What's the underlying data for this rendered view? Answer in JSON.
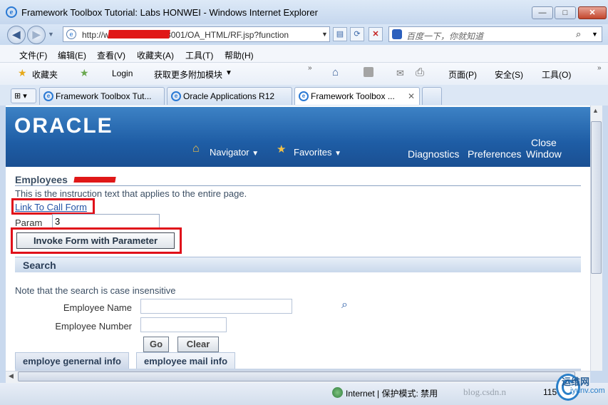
{
  "window": {
    "title": "Framework Toolbox Tutorial: Labs HONWEI - Windows Internet Explorer",
    "min": "—",
    "max": "□",
    "close": "✕"
  },
  "address": {
    "url": "http://www.xxxxx.com:8001/OA_HTML/RF.jsp?function",
    "search_placeholder": "百度一下，你就知道"
  },
  "menu": [
    "文件(F)",
    "编辑(E)",
    "查看(V)",
    "收藏夹(A)",
    "工具(T)",
    "帮助(H)"
  ],
  "favorites": {
    "label": "收藏夹",
    "login": "Login",
    "addons": "获取更多附加模块"
  },
  "command": {
    "page": "页面(P)",
    "safety": "安全(S)",
    "tools": "工具(O)"
  },
  "tabs": [
    {
      "label": "Framework Toolbox Tut..."
    },
    {
      "label": "Oracle Applications R12"
    },
    {
      "label": "Framework Toolbox ..."
    }
  ],
  "oracle": {
    "logo": "ORACLE",
    "navigator": "Navigator",
    "favorites": "Favorites",
    "diagnostics": "Diagnostics",
    "preferences": "Preferences",
    "close_window_1": "Close",
    "close_window_2": "Window"
  },
  "page": {
    "header": "Employees",
    "instruction": "This is the instruction text that applies to the entire page.",
    "link_call_form": "Link To Call Form",
    "param_label": "Param",
    "param_value": "3",
    "invoke_button": "Invoke Form with Parameter",
    "search_header": "Search",
    "note": "Note that the search is case insensitive",
    "employee_name_label": "Employee Name",
    "employee_number_label": "Employee Number",
    "go_button": "Go",
    "clear_button": "Clear",
    "subtabs": [
      "employe genernal info",
      "employee mail info"
    ]
  },
  "status": {
    "zone": "Internet | 保护模式: 禁用",
    "zoom": "115%",
    "watermark": "blog.csdn.n",
    "logo_text": "运维网",
    "logo_sub": "iyunv.com"
  },
  "colors": {
    "oracle_banner": "#1e5da5",
    "highlight_box": "#e0101a",
    "link": "#2353a6"
  }
}
